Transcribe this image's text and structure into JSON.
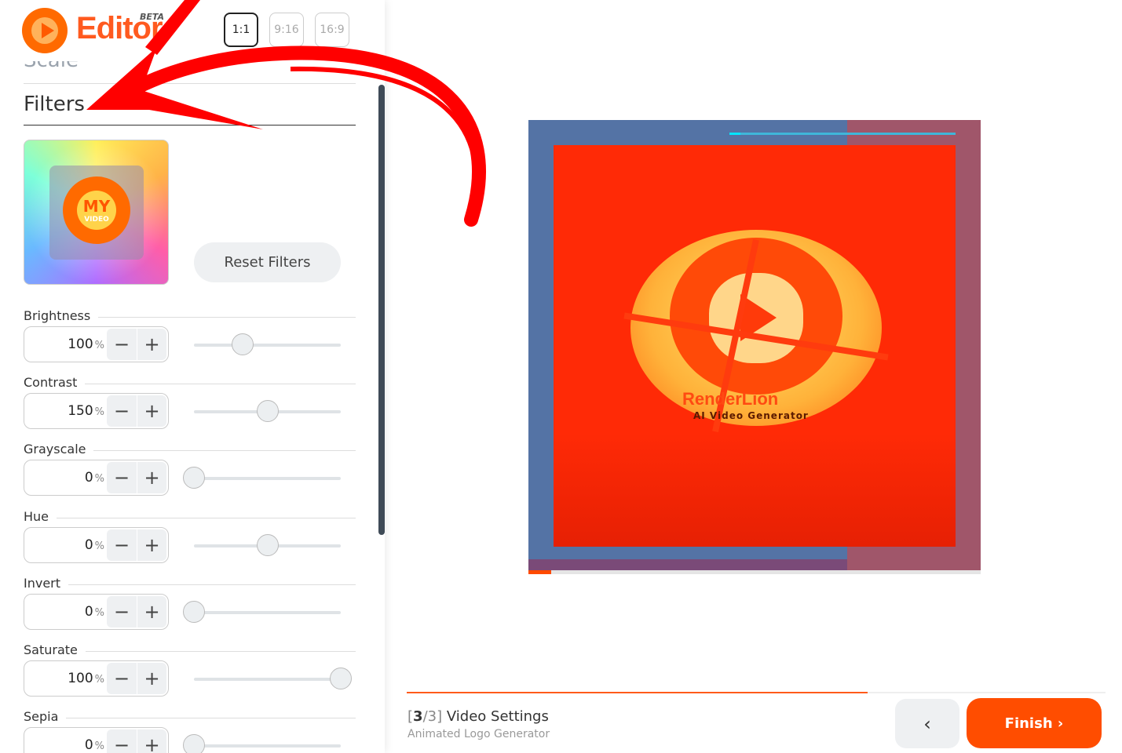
{
  "header": {
    "logo_text": "Editor",
    "logo_badge": "BETA",
    "ratios": [
      {
        "label": "1:1",
        "active": true
      },
      {
        "label": "9:16",
        "active": false
      },
      {
        "label": "16:9",
        "active": false
      }
    ]
  },
  "sidebar": {
    "scale_label": "Scale",
    "filters_title": "Filters",
    "thumb_text_top": "MY",
    "thumb_text_bottom": "VIDEO",
    "reset_label": "Reset Filters",
    "filters": [
      {
        "label": "Brightness",
        "value": "100",
        "unit": "%",
        "level": 0.33
      },
      {
        "label": "Contrast",
        "value": "150",
        "unit": "%",
        "level": 0.5
      },
      {
        "label": "Grayscale",
        "value": "0",
        "unit": "%",
        "level": 0.0
      },
      {
        "label": "Hue",
        "value": "0",
        "unit": "%",
        "level": 0.5
      },
      {
        "label": "Invert",
        "value": "0",
        "unit": "%",
        "level": 0.0
      },
      {
        "label": "Saturate",
        "value": "100",
        "unit": "%",
        "level": 1.0
      },
      {
        "label": "Sepia",
        "value": "0",
        "unit": "%",
        "level": 0.0
      }
    ]
  },
  "preview": {
    "brand_name": "RenderLion",
    "brand_tagline": "AI Video Generator",
    "playback_progress": 0.05
  },
  "footer": {
    "step_current": "3",
    "step_total": "3",
    "step_name": "Video Settings",
    "subtitle": "Animated Logo Generator",
    "back_icon": "‹",
    "finish_label": "Finish",
    "finish_icon": "›",
    "progress": 0.66
  },
  "colors": {
    "accent": "#ff4d00",
    "annotation": "#ff0000"
  }
}
